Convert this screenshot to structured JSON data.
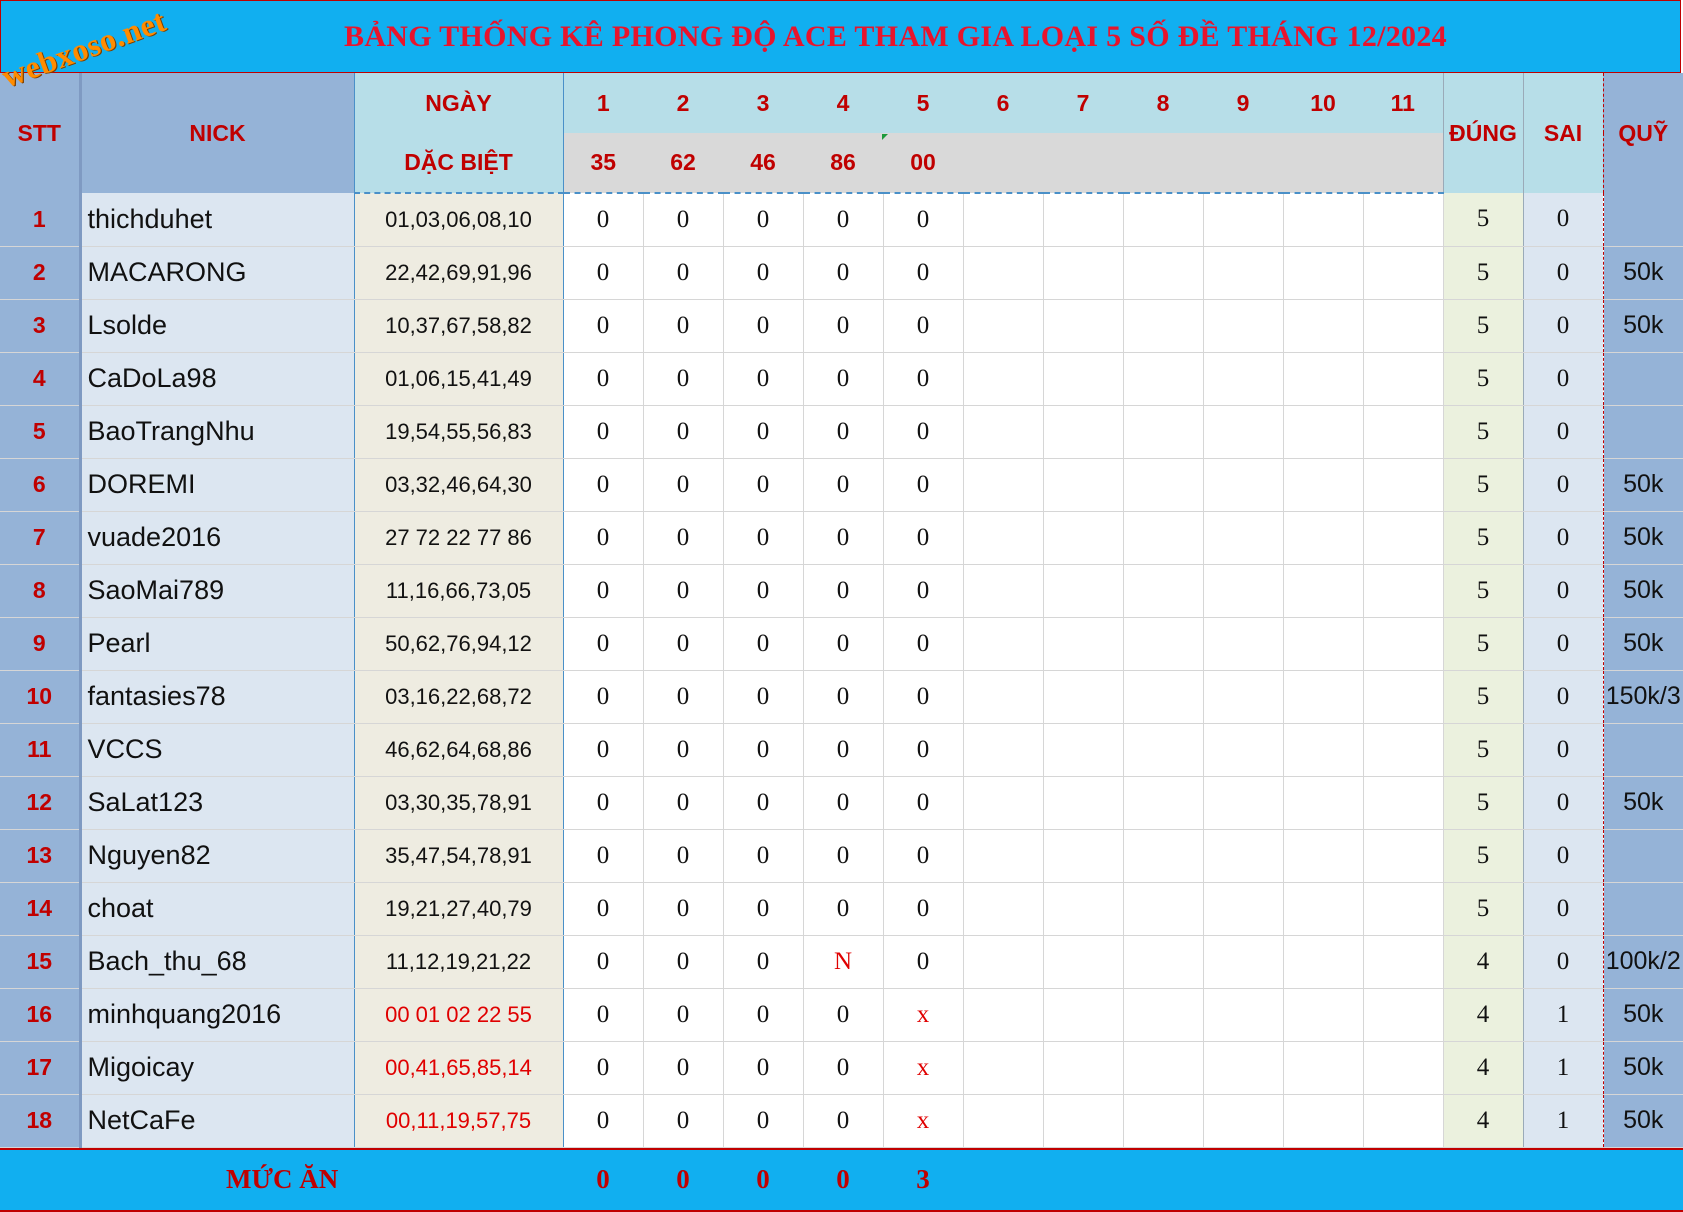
{
  "watermark": "webxoso.net",
  "title": "BẢNG THỐNG KÊ PHONG ĐỘ ACE THAM GIA LOẠI 5 SỐ ĐỀ THÁNG 12/2024",
  "headers": {
    "stt": "STT",
    "nick": "NICK",
    "ngay": "NGÀY",
    "dac_biet": "DẶC BIỆT",
    "days": [
      "1",
      "2",
      "3",
      "4",
      "5",
      "6",
      "7",
      "8",
      "9",
      "10",
      "11"
    ],
    "results": [
      "35",
      "62",
      "46",
      "86",
      "00",
      "",
      "",
      "",
      "",
      "",
      ""
    ],
    "dung": "ĐÚNG",
    "sai": "SAI",
    "quy": "QUỸ"
  },
  "rows": [
    {
      "stt": "1",
      "nick": "thichduhet",
      "numbers": "01,03,06,08,10",
      "vals": [
        "0",
        "0",
        "0",
        "0",
        "0"
      ],
      "dung": "5",
      "sai": "0",
      "quy": ""
    },
    {
      "stt": "2",
      "nick": "MACARONG",
      "numbers": "22,42,69,91,96",
      "vals": [
        "0",
        "0",
        "0",
        "0",
        "0"
      ],
      "dung": "5",
      "sai": "0",
      "quy": "50k"
    },
    {
      "stt": "3",
      "nick": "Lsolde",
      "numbers": "10,37,67,58,82",
      "vals": [
        "0",
        "0",
        "0",
        "0",
        "0"
      ],
      "dung": "5",
      "sai": "0",
      "quy": "50k"
    },
    {
      "stt": "4",
      "nick": "CaDoLa98",
      "numbers": "01,06,15,41,49",
      "vals": [
        "0",
        "0",
        "0",
        "0",
        "0"
      ],
      "dung": "5",
      "sai": "0",
      "quy": ""
    },
    {
      "stt": "5",
      "nick": "BaoTrangNhu",
      "numbers": "19,54,55,56,83",
      "vals": [
        "0",
        "0",
        "0",
        "0",
        "0"
      ],
      "dung": "5",
      "sai": "0",
      "quy": ""
    },
    {
      "stt": "6",
      "nick": "DOREMI",
      "numbers": "03,32,46,64,30",
      "vals": [
        "0",
        "0",
        "0",
        "0",
        "0"
      ],
      "dung": "5",
      "sai": "0",
      "quy": "50k"
    },
    {
      "stt": "7",
      "nick": "vuade2016",
      "numbers": "27 72 22 77 86",
      "vals": [
        "0",
        "0",
        "0",
        "0",
        "0"
      ],
      "dung": "5",
      "sai": "0",
      "quy": "50k"
    },
    {
      "stt": "8",
      "nick": "SaoMai789",
      "numbers": "11,16,66,73,05",
      "vals": [
        "0",
        "0",
        "0",
        "0",
        "0"
      ],
      "dung": "5",
      "sai": "0",
      "quy": "50k"
    },
    {
      "stt": "9",
      "nick": "Pearl",
      "numbers": "50,62,76,94,12",
      "vals": [
        "0",
        "0",
        "0",
        "0",
        "0"
      ],
      "dung": "5",
      "sai": "0",
      "quy": "50k"
    },
    {
      "stt": "10",
      "nick": "fantasies78",
      "numbers": "03,16,22,68,72",
      "vals": [
        "0",
        "0",
        "0",
        "0",
        "0"
      ],
      "dung": "5",
      "sai": "0",
      "quy": "150k/3"
    },
    {
      "stt": "11",
      "nick": "VCCS",
      "numbers": "46,62,64,68,86",
      "vals": [
        "0",
        "0",
        "0",
        "0",
        "0"
      ],
      "dung": "5",
      "sai": "0",
      "quy": ""
    },
    {
      "stt": "12",
      "nick": "SaLat123",
      "numbers": "03,30,35,78,91",
      "vals": [
        "0",
        "0",
        "0",
        "0",
        "0"
      ],
      "dung": "5",
      "sai": "0",
      "quy": "50k"
    },
    {
      "stt": "13",
      "nick": "Nguyen82",
      "numbers": "35,47,54,78,91",
      "vals": [
        "0",
        "0",
        "0",
        "0",
        "0"
      ],
      "dung": "5",
      "sai": "0",
      "quy": ""
    },
    {
      "stt": "14",
      "nick": "choat",
      "numbers": "19,21,27,40,79",
      "vals": [
        "0",
        "0",
        "0",
        "0",
        "0"
      ],
      "dung": "5",
      "sai": "0",
      "quy": ""
    },
    {
      "stt": "15",
      "nick": "Bach_thu_68",
      "numbers": "11,12,19,21,22",
      "vals": [
        "0",
        "0",
        "0",
        "N",
        "0"
      ],
      "dung": "4",
      "sai": "0",
      "quy": "100k/2"
    },
    {
      "stt": "16",
      "nick": "minhquang2016",
      "numbers": "00 01 02 22 55",
      "vals": [
        "0",
        "0",
        "0",
        "0",
        "x"
      ],
      "dung": "4",
      "sai": "1",
      "quy": "50k"
    },
    {
      "stt": "17",
      "nick": "Migoicay",
      "numbers": "00,41,65,85,14",
      "vals": [
        "0",
        "0",
        "0",
        "0",
        "x"
      ],
      "dung": "4",
      "sai": "1",
      "quy": "50k"
    },
    {
      "stt": "18",
      "nick": "NetCaFe",
      "numbers": "00,11,19,57,75",
      "vals": [
        "0",
        "0",
        "0",
        "0",
        "x"
      ],
      "dung": "4",
      "sai": "1",
      "quy": "50k"
    }
  ],
  "footer": {
    "label": "MỨC ĂN",
    "values": [
      "0",
      "0",
      "0",
      "0",
      "3"
    ]
  },
  "colors": {
    "title_bg": "#11aff0",
    "title_text": "#e8142c",
    "header_text": "#c00000",
    "highlight_red": "#e00000",
    "watermark": "#ff8c00"
  }
}
